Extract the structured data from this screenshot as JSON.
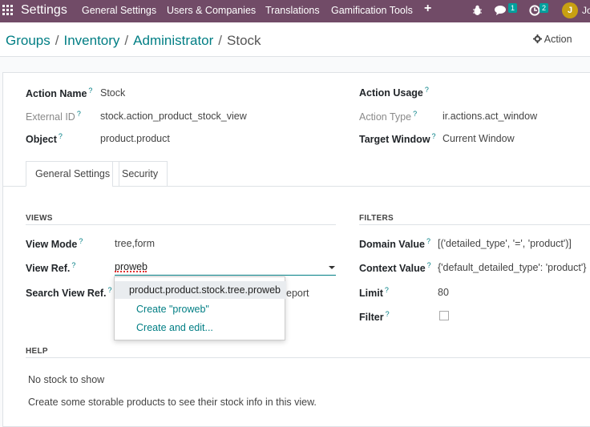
{
  "navbar": {
    "brand": "Settings",
    "menu": [
      "General Settings",
      "Users & Companies",
      "Translations",
      "Gamification Tools"
    ],
    "plus": "+",
    "messages_count": "1",
    "activities_count": "2",
    "avatar_initial": "J",
    "user_name": "Jo"
  },
  "breadcrumb": [
    "Groups",
    "Inventory",
    "Administrator"
  ],
  "breadcrumb_current": "Stock",
  "action_label": "Action",
  "form": {
    "action_name_label": "Action Name",
    "action_name_value": "Stock",
    "external_id_label": "External ID",
    "external_id_value": "stock.action_product_stock_view",
    "object_label": "Object",
    "object_value": "product.product",
    "action_usage_label": "Action Usage",
    "action_type_label": "Action Type",
    "action_type_value": "ir.actions.act_window",
    "target_window_label": "Target Window",
    "target_window_value": "Current Window",
    "help_marker": "?"
  },
  "tabs": [
    "General Settings",
    "Security"
  ],
  "views": {
    "title": "VIEWS",
    "view_mode_label": "View Mode",
    "view_mode_value": "tree,form",
    "view_ref_label": "View Ref.",
    "view_ref_value": "proweb",
    "search_view_label": "Search View Ref.",
    "search_view_value_partial": "eport"
  },
  "filters": {
    "title": "FILTERS",
    "domain_label": "Domain Value",
    "domain_value": "[('detailed_type', '=', 'product')]",
    "context_label": "Context Value",
    "context_value": "{'default_detailed_type': 'product'}",
    "limit_label": "Limit",
    "limit_value": "80",
    "filter_label": "Filter"
  },
  "dropdown": {
    "selected": "product.product.stock.tree.proweb",
    "create": "Create \"proweb\"",
    "create_edit": "Create and edit..."
  },
  "help": {
    "title": "HELP",
    "line1": "No stock to show",
    "line2": "Create some storable products to see their stock info in this view."
  },
  "colors": {
    "brand": "#714B67",
    "accent": "#017E84",
    "badge": "#00A09D"
  }
}
